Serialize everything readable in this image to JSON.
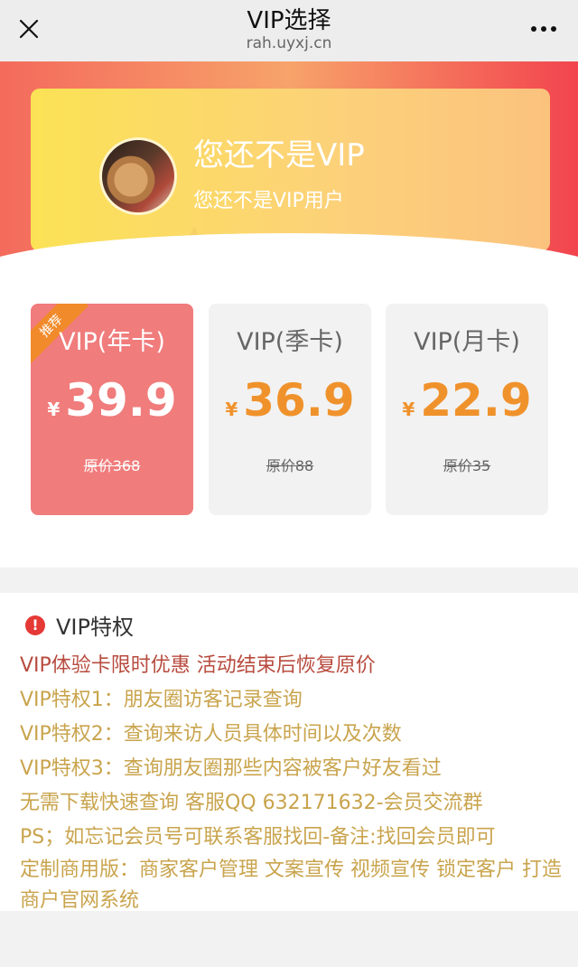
{
  "header": {
    "title": "VIP选择",
    "domain": "rah.uyxj.cn",
    "close_icon": "close-icon",
    "more_icon": "more-icon"
  },
  "profile": {
    "vip_title": "您还不是VIP",
    "vip_subtitle": "您还不是VIP用户",
    "avatar": "avatar-cat-image"
  },
  "plans": [
    {
      "name": "VIP(年卡)",
      "currency": "¥",
      "price": "39.9",
      "original": "原价368",
      "badge": "推荐",
      "selected": true
    },
    {
      "name": "VIP(季卡)",
      "currency": "¥",
      "price": "36.9",
      "original": "原价88",
      "selected": false
    },
    {
      "name": "VIP(月卡)",
      "currency": "¥",
      "price": "22.9",
      "original": "原价35",
      "selected": false
    }
  ],
  "privileges": {
    "icon": "info-icon",
    "icon_glyph": "!",
    "title": "VIP特权",
    "lines": [
      "VIP体验卡限时优惠 活动结束后恢复原价",
      "VIP特权1：朋友圈访客记录查询",
      "VIP特权2：查询来访人员具体时间以及次数",
      "VIP特权3：查询朋友圈那些内容被客户好友看过",
      "无需下载快速查询 客服QQ 632171632-会员交流群",
      "PS；如忘记会员号可联系客服找回-备注:找回会员即可"
    ],
    "wrap_line": "定制商用版：商家客户管理 文案宣传 视频宣传 锁定客户 打造商户官网系统"
  },
  "colors": {
    "selected_plan": "#f07c7c",
    "price_orange": "#f0922c",
    "privilege_text": "#c9a44d",
    "privilege_red": "#b84b3e",
    "badge": "#f18a2a"
  }
}
